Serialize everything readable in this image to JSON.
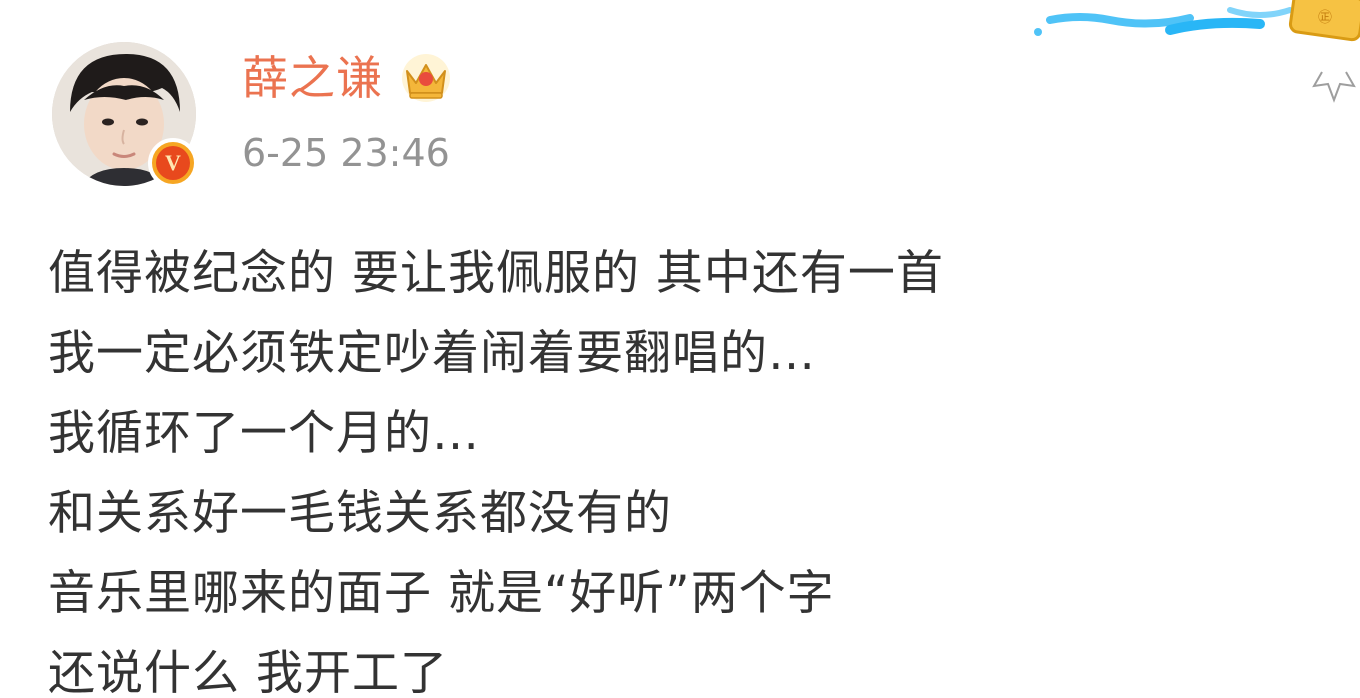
{
  "post": {
    "author": {
      "name": "薛之谦",
      "verified_badge": "V",
      "membership_icon": "crown-icon"
    },
    "timestamp": "6-25 23:46",
    "text_lines": [
      "值得被纪念的 要让我佩服的 其中还有一首",
      "我一定必须铁定吵着闹着要翻唱的…",
      "我循环了一个月的…",
      "和关系好一毛钱关系都没有的",
      "音乐里哪来的面子  就是“好听”两个字",
      "还说什么 我开工了"
    ]
  },
  "colors": {
    "username": "#eb7350",
    "timestamp": "#939393",
    "text": "#333333",
    "verified_orange": "#f6a623",
    "verified_red": "#e8491d",
    "crown_gold": "#f4b63a",
    "crown_red": "#e94c3d"
  }
}
